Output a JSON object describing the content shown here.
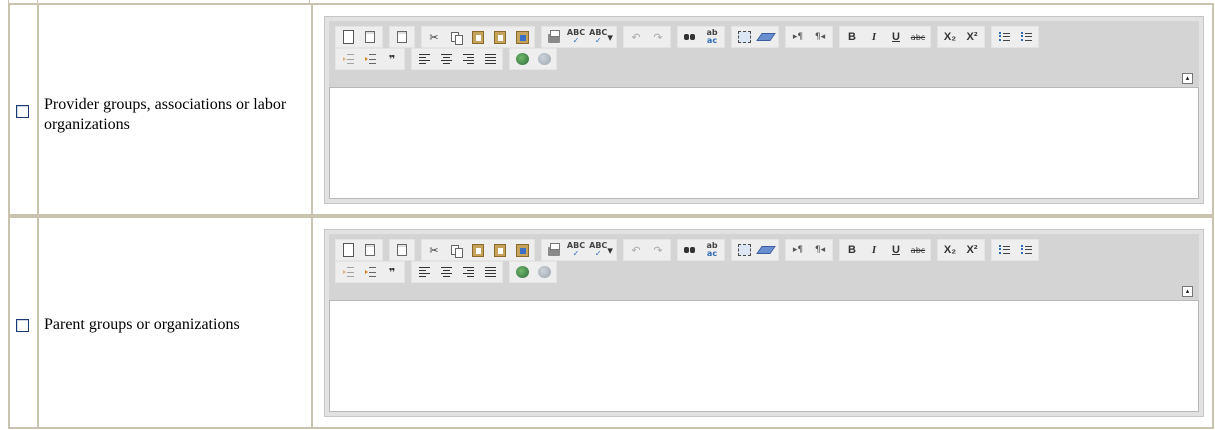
{
  "rows": [
    {
      "label": "Provider groups, associations or labor organizations",
      "checked": false
    },
    {
      "label": "Parent groups or organizations",
      "checked": false
    }
  ],
  "toolbar": {
    "groups_row1": [
      [
        "new-page-icon",
        "preview-icon"
      ],
      [
        "templates-icon"
      ],
      [
        "cut-icon",
        "copy-icon",
        "paste-icon",
        "paste-text-icon",
        "paste-from-word-icon"
      ],
      [
        "print-icon",
        "spellcheck-icon",
        "spellcheck-as-you-type-icon"
      ],
      [
        "undo-icon",
        "redo-icon"
      ],
      [
        "find-icon",
        "replace-icon"
      ],
      [
        "select-all-icon",
        "remove-format-icon"
      ],
      [
        "ltr-icon",
        "rtl-icon"
      ],
      [
        "bold-icon",
        "italic-icon",
        "underline-icon",
        "strikethrough-icon"
      ],
      [
        "subscript-icon",
        "superscript-icon"
      ],
      [
        "numbered-list-icon",
        "bulleted-list-icon"
      ]
    ],
    "groups_row2": [
      [
        "outdent-icon",
        "indent-icon",
        "blockquote-icon"
      ],
      [
        "align-left-icon",
        "align-center-icon",
        "align-right-icon",
        "justify-icon"
      ],
      [
        "link-icon",
        "unlink-icon"
      ]
    ],
    "glyphs": {
      "bold": "B",
      "italic": "I",
      "underline": "U",
      "strike": "abc",
      "sub": "X₂",
      "sup": "X²",
      "quote": "❞",
      "undo": "↶",
      "redo": "↷",
      "ltr": "▸¶",
      "rtl": "¶◂",
      "collapse": "▴"
    }
  }
}
